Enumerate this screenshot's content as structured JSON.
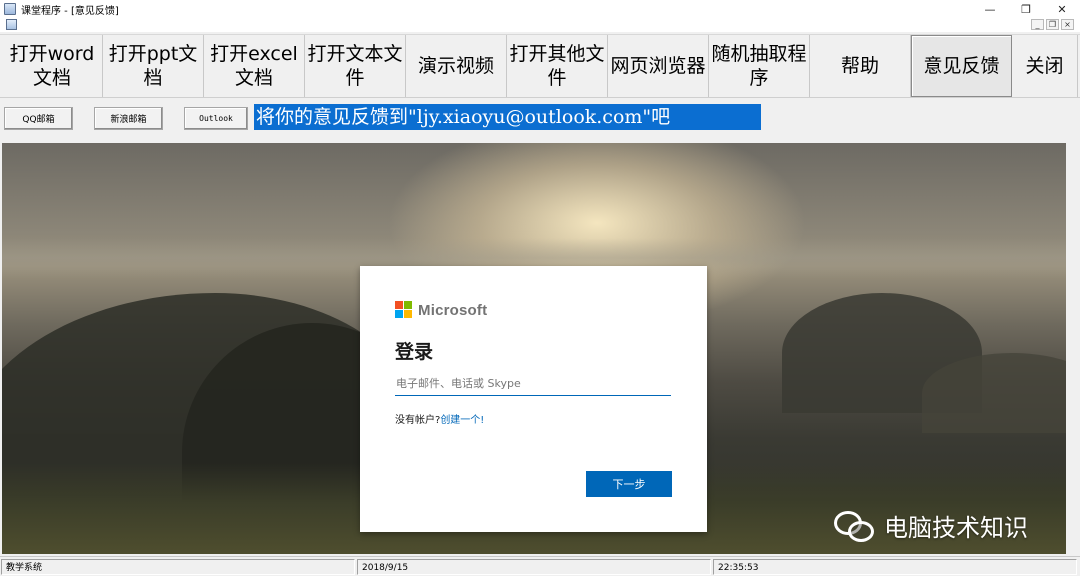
{
  "window": {
    "title": "课堂程序 - [意见反馈]",
    "controls": [
      "—",
      "❐",
      "✕"
    ],
    "mdi_controls": [
      "_",
      "❐",
      "×"
    ]
  },
  "toolbar": [
    {
      "label": "打开word\n文档"
    },
    {
      "label": "打开ppt文\n档"
    },
    {
      "label": "打开excel\n文档"
    },
    {
      "label": "打开文本文\n件"
    },
    {
      "label": "演示视频"
    },
    {
      "label": "打开其他文\n件"
    },
    {
      "label": "网页浏览器"
    },
    {
      "label": "随机抽取程\n序"
    },
    {
      "label": "帮助"
    },
    {
      "label": "意见反馈",
      "active": true
    },
    {
      "label": "关闭"
    }
  ],
  "subbar": {
    "qq_mail": "QQ邮箱",
    "sina_mail": "新浪邮箱",
    "outlook": "Outlook",
    "banner": "将你的意见反馈到\"ljy.xiaoyu@outlook.com\"吧"
  },
  "login": {
    "brand": "Microsoft",
    "title": "登录",
    "email_placeholder": "电子邮件、电话或 Skype",
    "no_account": "没有帐户?",
    "create_link": "创建一个!",
    "next_button": "下一步"
  },
  "watermark": {
    "text": "电脑技术知识"
  },
  "statusbar": {
    "system": "教学系统",
    "date": "2018/9/15",
    "time": "22:35:53"
  },
  "colors": {
    "banner_bg": "#0b6ed1",
    "ms_blue": "#0067b8",
    "ms_red": "#f25022",
    "ms_green": "#7fba00",
    "ms_blue_sq": "#00a4ef",
    "ms_yellow": "#ffb900"
  }
}
